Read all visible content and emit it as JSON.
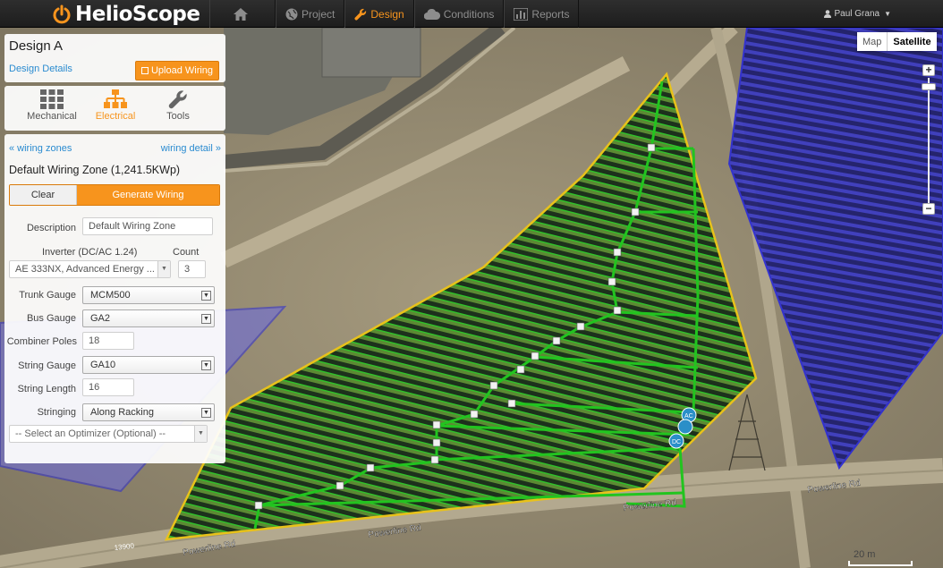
{
  "app": {
    "brand": "HelioScope"
  },
  "nav": {
    "home_icon": "home-icon",
    "items": [
      {
        "label": "Project",
        "icon": "globe-icon"
      },
      {
        "label": "Design",
        "icon": "wrench-icon"
      },
      {
        "label": "Conditions",
        "icon": "cloud-icon"
      },
      {
        "label": "Reports",
        "icon": "bar-chart-icon"
      }
    ],
    "active": "Design",
    "user": "Paul Grana"
  },
  "design": {
    "title": "Design A",
    "details_link": "Design Details",
    "upload_label": "Upload Wiring"
  },
  "tabs": [
    {
      "label": "Mechanical",
      "icon": "grid-icon"
    },
    {
      "label": "Electrical",
      "icon": "sitemap-icon"
    },
    {
      "label": "Tools",
      "icon": "wrench-icon"
    }
  ],
  "wiring": {
    "back_link": "« wiring zones",
    "detail_link": "wiring detail »",
    "zone_title": "Default Wiring Zone (1,241.5KWp)",
    "clear_label": "Clear",
    "generate_label": "Generate Wiring",
    "description_label": "Description",
    "description_value": "Default Wiring Zone",
    "inverter_label": "Inverter (DC/AC 1.24)",
    "count_label": "Count",
    "inverter_value": "AE 333NX, Advanced Energy ...",
    "count_value": "3",
    "trunk_label": "Trunk Gauge",
    "trunk_value": "MCM500",
    "bus_label": "Bus Gauge",
    "bus_value": "GA2",
    "poles_label": "Combiner Poles",
    "poles_value": "18",
    "string_gauge_label": "String Gauge",
    "string_gauge_value": "GA10",
    "string_length_label": "String Length",
    "string_length_value": "16",
    "stringing_label": "Stringing",
    "stringing_value": "Along Racking",
    "optimizer_value": "-- Select an Optimizer (Optional) --"
  },
  "map": {
    "type_map": "Map",
    "type_satellite": "Satellite",
    "zoom_in": "+",
    "zoom_out": "−",
    "scale": "20 m",
    "road_labels": [
      "Powerline Rd",
      "Powerline Rd",
      "Powerline Rd",
      "Powerline Rd"
    ],
    "address": "13900",
    "colors": {
      "accent": "#f7941d",
      "zone_outline": "#e8c21a",
      "panels": "#1c2f1c",
      "wiring": "#22c41f",
      "neighbor_zone": "#2b2bd6"
    }
  }
}
